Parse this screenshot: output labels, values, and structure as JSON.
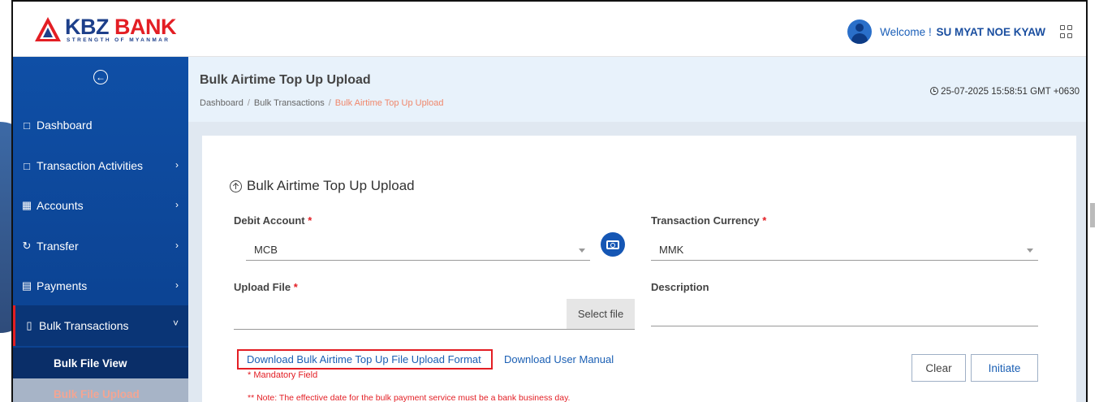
{
  "brand": {
    "name_part1": "KBZ",
    "name_part2": " BANK",
    "tagline": "STRENGTH OF MYANMAR",
    "primary_color": "#1d3f8a",
    "accent_color": "#e31e24"
  },
  "header": {
    "welcome_prefix": "Welcome !",
    "user_name": "SU MYAT NOE KYAW"
  },
  "sidebar": {
    "items": [
      {
        "label": "Dashboard",
        "icon": "monitor-icon"
      },
      {
        "label": "Transaction Activities",
        "icon": "monitor-icon"
      },
      {
        "label": "Accounts",
        "icon": "folder-icon"
      },
      {
        "label": "Transfer",
        "icon": "transfer-icon"
      },
      {
        "label": "Payments",
        "icon": "receipt-icon"
      },
      {
        "label": "Bulk Transactions",
        "icon": "document-icon"
      }
    ],
    "sub_items": [
      {
        "label": "Bulk File View"
      },
      {
        "label": "Bulk File Upload"
      }
    ]
  },
  "page": {
    "title": "Bulk Airtime Top Up Upload",
    "breadcrumbs": [
      "Dashboard",
      "Bulk Transactions",
      "Bulk Airtime Top Up Upload"
    ],
    "datetime": "25-07-2025 15:58:51 GMT +0630"
  },
  "form": {
    "title": "Bulk Airtime Top Up Upload",
    "debit_account": {
      "label": "Debit Account",
      "required_mark": "*",
      "value": "MCB"
    },
    "currency": {
      "label": "Transaction Currency",
      "required_mark": "*",
      "value": "MMK"
    },
    "upload_file": {
      "label": "Upload File",
      "required_mark": "*",
      "button": "Select file"
    },
    "description": {
      "label": "Description"
    },
    "download_format_link": "Download Bulk Airtime Top Up File Upload Format",
    "download_manual_link": "Download User Manual",
    "mandatory_note": "* Mandatory Field",
    "effective_note": "** Note: The effective date for the bulk payment service must be a bank business day.",
    "clear_button": "Clear",
    "initiate_button": "Initiate"
  }
}
